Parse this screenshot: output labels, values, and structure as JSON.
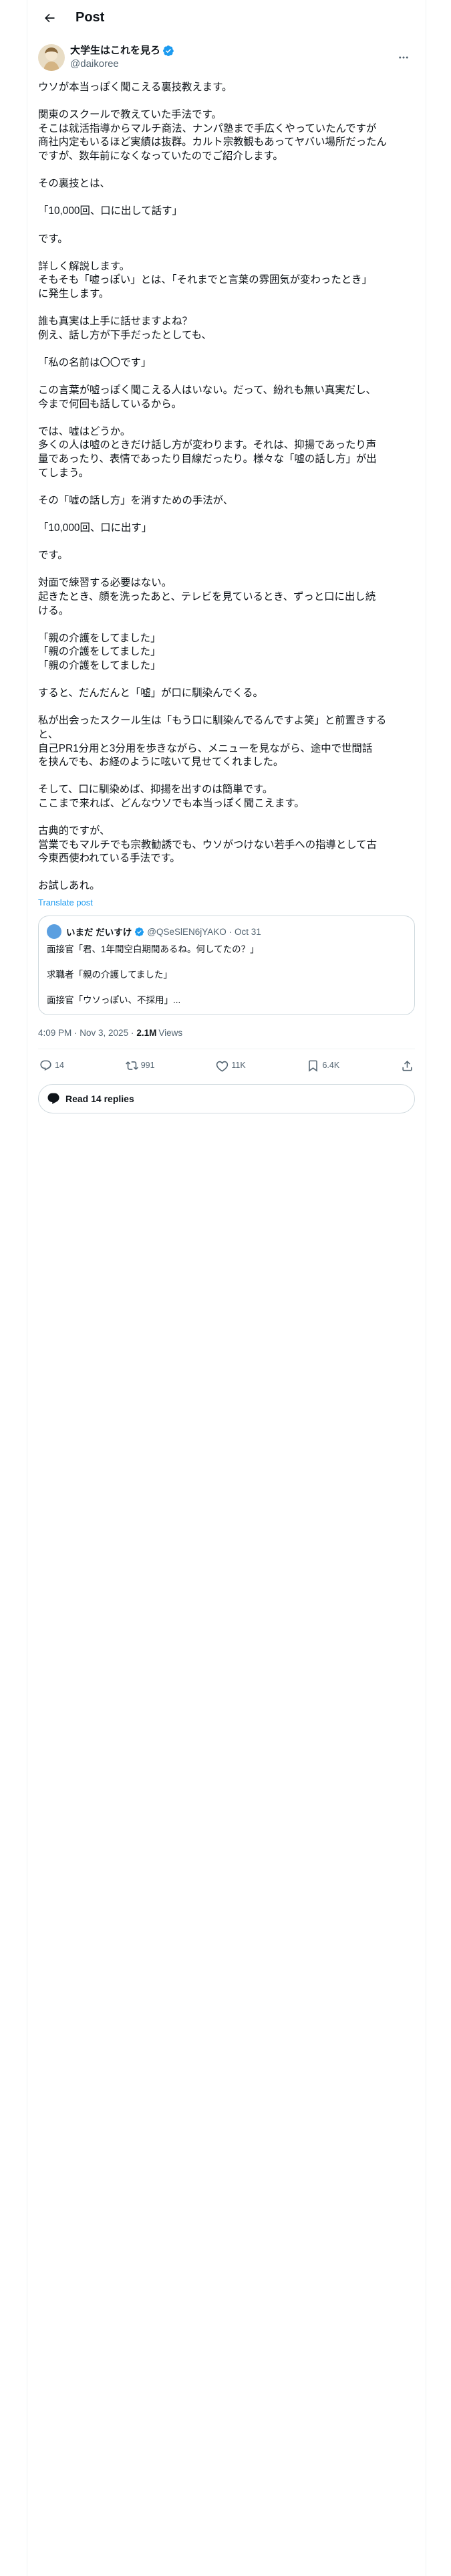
{
  "header": {
    "title": "Post"
  },
  "author": {
    "name": "大学生はこれを見ろ",
    "handle": "@daikoree"
  },
  "post": {
    "lines": [
      "ウソが本当っぽく聞こえる裏技教えます。",
      "",
      "関東のスクールで教えていた手法です。",
      "そこは就活指導からマルチ商法、ナンパ塾まで手広くやっていたんですが",
      "商社内定もいるほど実績は抜群。カルト宗教観もあってヤバい場所だったん",
      "ですが、数年前になくなっていたのでご紹介します。",
      "",
      "その裏技とは、",
      "",
      "「10,000回、口に出して話す」",
      "",
      "です。",
      "",
      "詳しく解説します。",
      "そもそも「嘘っぽい」とは、「それまでと言葉の雰囲気が変わったとき」",
      "に発生します。",
      "",
      "誰も真実は上手に話せますよね？",
      "例え、話し方が下手だったとしても、",
      "",
      "「私の名前は〇〇です」",
      "",
      "この言葉が嘘っぽく聞こえる人はいない。だって、紛れも無い真実だし、",
      "今まで何回も話しているから。",
      "",
      "では、嘘はどうか。",
      "多くの人は嘘のときだけ話し方が変わります。それは、抑揚であったり声",
      "量であったり、表情であったり目線だったり。様々な「嘘の話し方」が出",
      "てしまう。",
      "",
      "その「嘘の話し方」を消すための手法が、",
      "",
      "「10,000回、口に出す」",
      "",
      "です。",
      "",
      "対面で練習する必要はない。",
      "起きたとき、顔を洗ったあと、テレビを見ているとき、ずっと口に出し続",
      "ける。",
      "",
      "「親の介護をしてました」",
      "「親の介護をしてました」",
      "「親の介護をしてました」",
      "",
      "すると、だんだんと「嘘」が口に馴染んでくる。",
      "",
      "私が出会ったスクール生は「もう口に馴染んでるんですよ笑」と前置きする",
      "と、",
      "自己PR1分用と3分用を歩きながら、メニューを見ながら、途中で世間話",
      "を挟んでも、お経のように呟いて見せてくれました。",
      "",
      "そして、口に馴染めば、抑揚を出すのは簡単です。",
      "ここまで来れば、どんなウソでも本当っぽく聞こえます。",
      "",
      "古典的ですが、",
      "営業でもマルチでも宗教勧誘でも、ウソがつけない若手への指導として古",
      "今東西使われている手法です。",
      "",
      "お試しあれ。"
    ],
    "translate": "Translate post"
  },
  "quote": {
    "name": "いまだ だいすけ",
    "handle": "@QSeSlEN6jYAKO",
    "date": "· Oct 31",
    "lines": [
      "面接官「君、1年間空白期間あるね。何してたの？」",
      "",
      "求職者「親の介護してました」",
      "",
      "面接官「ウソっぽい、不採用」..."
    ]
  },
  "meta": {
    "time": "4:09 PM · Nov 3, 2025 · ",
    "views": "2.1M",
    "views_label": "Views"
  },
  "actions": {
    "replies": "14",
    "reposts": "991",
    "likes": "11K",
    "bookmarks": "6.4K"
  },
  "read_replies": "Read 14 replies",
  "colors": {
    "accent": "#1d9bf0",
    "text": "#0f1419",
    "muted": "#536471",
    "border": "#cfd9de"
  },
  "icons": [
    "back-arrow-icon",
    "verified-badge-icon",
    "more-icon",
    "reply-icon",
    "repost-icon",
    "like-icon",
    "bookmark-icon",
    "share-icon",
    "speech-bubble-icon"
  ]
}
